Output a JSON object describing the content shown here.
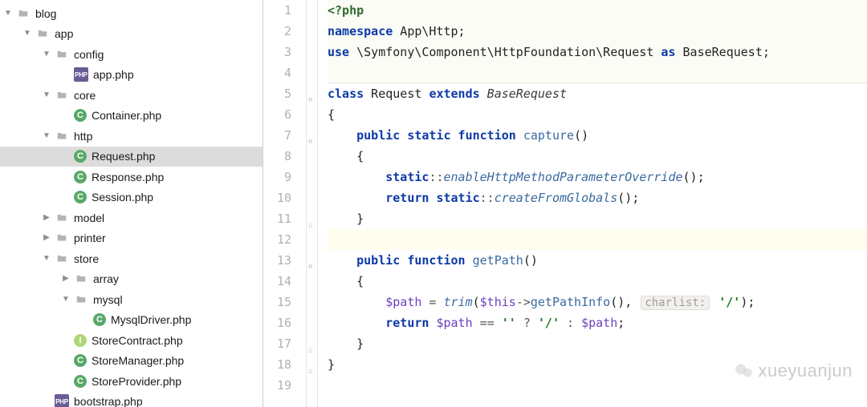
{
  "tree": [
    {
      "depth": 0,
      "disclosure": "open",
      "icon": "folder",
      "label": "blog",
      "selected": false
    },
    {
      "depth": 1,
      "disclosure": "open",
      "icon": "folder",
      "label": "app",
      "selected": false
    },
    {
      "depth": 2,
      "disclosure": "open",
      "icon": "folder",
      "label": "config",
      "selected": false
    },
    {
      "depth": 3,
      "disclosure": "none",
      "icon": "php",
      "label": "app.php",
      "selected": false
    },
    {
      "depth": 2,
      "disclosure": "open",
      "icon": "folder",
      "label": "core",
      "selected": false
    },
    {
      "depth": 3,
      "disclosure": "none",
      "icon": "class-c",
      "label": "Container.php",
      "selected": false
    },
    {
      "depth": 2,
      "disclosure": "open",
      "icon": "folder",
      "label": "http",
      "selected": false
    },
    {
      "depth": 3,
      "disclosure": "none",
      "icon": "class-c",
      "label": "Request.php",
      "selected": true
    },
    {
      "depth": 3,
      "disclosure": "none",
      "icon": "class-c",
      "label": "Response.php",
      "selected": false
    },
    {
      "depth": 3,
      "disclosure": "none",
      "icon": "class-c",
      "label": "Session.php",
      "selected": false
    },
    {
      "depth": 2,
      "disclosure": "closed",
      "icon": "folder",
      "label": "model",
      "selected": false
    },
    {
      "depth": 2,
      "disclosure": "closed",
      "icon": "folder",
      "label": "printer",
      "selected": false
    },
    {
      "depth": 2,
      "disclosure": "open",
      "icon": "folder",
      "label": "store",
      "selected": false
    },
    {
      "depth": 3,
      "disclosure": "closed",
      "icon": "folder",
      "label": "array",
      "selected": false
    },
    {
      "depth": 3,
      "disclosure": "open",
      "icon": "folder",
      "label": "mysql",
      "selected": false
    },
    {
      "depth": 4,
      "disclosure": "none",
      "icon": "class-c",
      "label": "MysqlDriver.php",
      "selected": false
    },
    {
      "depth": 3,
      "disclosure": "none",
      "icon": "class-i",
      "label": "StoreContract.php",
      "selected": false
    },
    {
      "depth": 3,
      "disclosure": "none",
      "icon": "class-c",
      "label": "StoreManager.php",
      "selected": false
    },
    {
      "depth": 3,
      "disclosure": "none",
      "icon": "class-c",
      "label": "StoreProvider.php",
      "selected": false
    },
    {
      "depth": 2,
      "disclosure": "none",
      "icon": "php",
      "label": "bootstrap.php",
      "selected": false
    }
  ],
  "line_numbers": [
    "1",
    "2",
    "3",
    "4",
    "5",
    "6",
    "7",
    "8",
    "9",
    "10",
    "11",
    "12",
    "13",
    "14",
    "15",
    "16",
    "17",
    "18",
    "19"
  ],
  "code": {
    "l1_open": "<?php",
    "l2_ns": "namespace",
    "l2_path": " App\\Http;",
    "l3_use": "use",
    "l3_path": " \\Symfony\\Component\\HttpFoundation\\Request ",
    "l3_as": "as",
    "l3_alias": " BaseRequest;",
    "l5_class": "class",
    "l5_name": " Request ",
    "l5_ext": "extends",
    "l5_base": " BaseRequest",
    "l6": "{",
    "l7_pub": "public",
    "l7_static": " static",
    "l7_fn": " function",
    "l7_name": " capture",
    "l7_par": "()",
    "l8": "{",
    "l9_static": "static",
    "l9_dd": "::",
    "l9_m": "enableHttpMethodParameterOverride",
    "l9_end": "();",
    "l10_ret": "return",
    "l10_static": " static",
    "l10_dd": "::",
    "l10_m": "createFromGlobals",
    "l10_end": "();",
    "l11": "}",
    "l13_pub": "public",
    "l13_fn": " function",
    "l13_name": " getPath",
    "l13_par": "()",
    "l14": "{",
    "l15_var": "$path",
    "l15_eq": " = ",
    "l15_trim": "trim",
    "l15_op": "(",
    "l15_this": "$this",
    "l15_arrow": "->",
    "l15_m": "getPathInfo",
    "l15_call": "(), ",
    "l15_hint": "charlist:",
    "l15_str": " '/'",
    "l15_cp": ");",
    "l16_ret": "return",
    "l16_var": " $path",
    "l16_eq": " == ",
    "l16_empty": "''",
    "l16_q": " ? ",
    "l16_slash": "'/'",
    "l16_colon": " : ",
    "l16_var2": "$path",
    "l16_sc": ";",
    "l17": "}",
    "l18": "}"
  },
  "fold_marks": [
    {
      "line": 5,
      "glyph": "⊖"
    },
    {
      "line": 7,
      "glyph": "⊖"
    },
    {
      "line": 11,
      "glyph": "△"
    },
    {
      "line": 13,
      "glyph": "⊖"
    },
    {
      "line": 17,
      "glyph": "△"
    },
    {
      "line": 18,
      "glyph": "△"
    }
  ],
  "watermark": "xueyuanjun"
}
